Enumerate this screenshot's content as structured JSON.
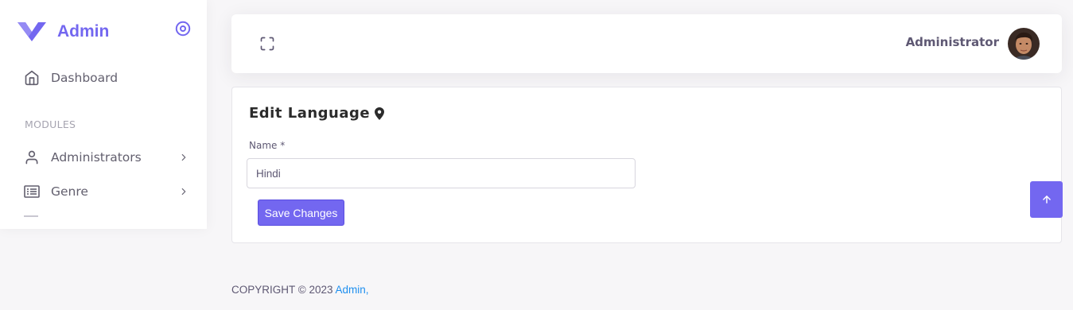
{
  "brand": {
    "name": "Admin",
    "logo_icon": "brand-v-logo",
    "accent_color": "#7367f0"
  },
  "sidebar": {
    "toggle_icon": "radio-circle-icon",
    "items_top": [
      {
        "label": "Dashboard",
        "icon": "home-icon"
      }
    ],
    "section_header": "MODULES",
    "items": [
      {
        "label": "Administrators",
        "icon": "user-icon",
        "has_submenu": true
      },
      {
        "label": "Genre",
        "icon": "list-icon",
        "has_submenu": true
      }
    ]
  },
  "navbar": {
    "fullscreen_icon": "maximize-icon",
    "user_name": "Administrator",
    "avatar_icon": "avatar"
  },
  "form": {
    "title": "Edit Language",
    "title_icon": "map-pin-icon",
    "name_label": "Name *",
    "name_value": "Hindi",
    "save_label": "Save Changes"
  },
  "scroll_top_icon": "arrow-up-icon",
  "footer": {
    "copyright": "COPYRIGHT © 2023 ",
    "link_text": "Admin,",
    "link_color": "#1e8fef"
  }
}
